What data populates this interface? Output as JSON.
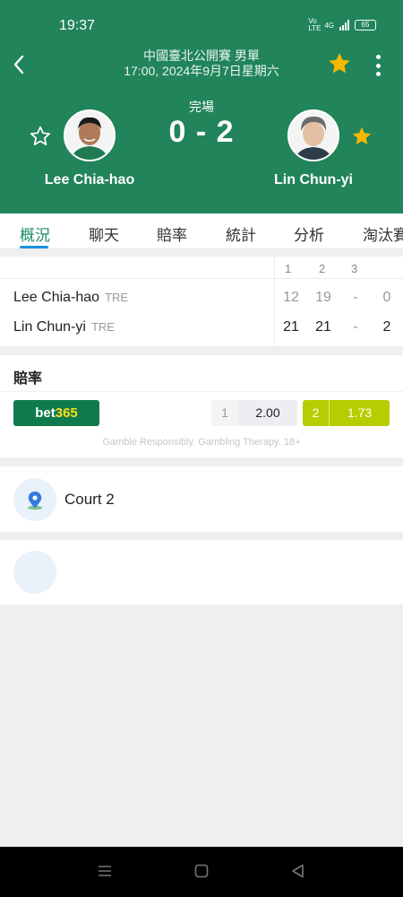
{
  "status_bar": {
    "time": "19:37",
    "network_label": "Vo LTE",
    "signal_label": "4G",
    "battery": "65"
  },
  "header": {
    "tournament": "中國臺北公開賽 男單",
    "datetime": "17:00, 2024年9月7日星期六",
    "status": "完場",
    "score": "0 - 2",
    "player_left": {
      "name": "Lee Chia-hao",
      "favorite": false
    },
    "player_right": {
      "name": "Lin Chun-yi",
      "favorite": true
    },
    "colors": {
      "background": "#21845a",
      "star": "#f5b800"
    }
  },
  "tabs": [
    {
      "label": "概況",
      "active": true
    },
    {
      "label": "聊天",
      "active": false
    },
    {
      "label": "賠率",
      "active": false
    },
    {
      "label": "統計",
      "active": false
    },
    {
      "label": "分析",
      "active": false
    },
    {
      "label": "淘汰賽",
      "active": false
    }
  ],
  "scoreboard": {
    "columns": [
      "1",
      "2",
      "3"
    ],
    "rows": [
      {
        "name": "Lee Chia-hao",
        "team": "TRE",
        "sets": [
          "12",
          "19",
          "-"
        ],
        "total": "0"
      },
      {
        "name": "Lin Chun-yi",
        "team": "TRE",
        "sets": [
          "21",
          "21",
          "-"
        ],
        "total": "2"
      }
    ]
  },
  "odds": {
    "title": "賠率",
    "bookmaker": {
      "prefix": "bet",
      "suffix": "365"
    },
    "options": [
      {
        "label": "1",
        "value": "2.00"
      },
      {
        "label": "2",
        "value": "1.73"
      }
    ],
    "disclaimer": "Gamble Responsibly. Gambling Therapy. 18+"
  },
  "venue": {
    "name": "Court 2",
    "icon": "location-pin-icon"
  },
  "navbar": {
    "icons": [
      "menu-icon",
      "home-icon",
      "back-triangle-icon"
    ]
  }
}
